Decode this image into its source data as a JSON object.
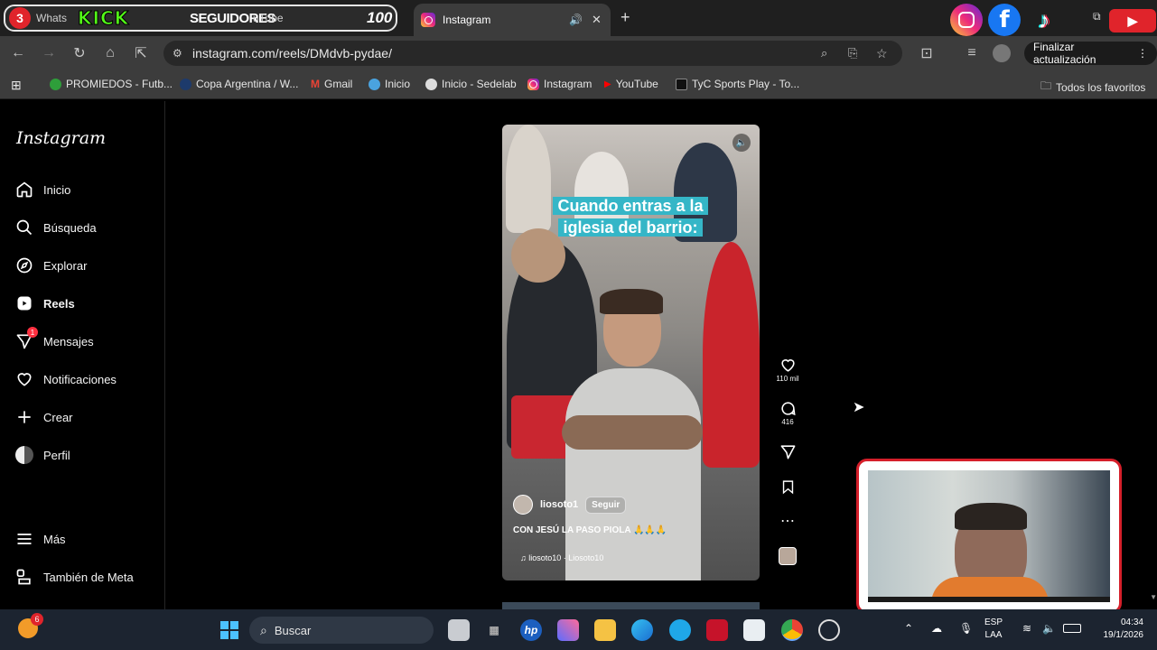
{
  "browser": {
    "tab_badge": "3",
    "tab1_text": "Whats",
    "overlay_kick": "KICK",
    "overlay_seguidores": "SEGUIDORES",
    "tab1_youtube": "uTube",
    "overlay_count": "100",
    "active_tab_title": "Instagram",
    "url": "instagram.com/reels/DMdvb-pydae/",
    "update_button": "Finalizar actualización",
    "bookmarks": [
      "PROMIEDOS - Futb...",
      "Copa Argentina / W...",
      "Gmail",
      "Inicio",
      "Inicio - Sedelab",
      "Instagram",
      "YouTube",
      "TyC Sports Play - To..."
    ],
    "all_bookmarks": "Todos los favoritos"
  },
  "instagram": {
    "logo": "Instagram",
    "nav": [
      {
        "label": "Inicio",
        "icon": "home-icon"
      },
      {
        "label": "Búsqueda",
        "icon": "search-icon"
      },
      {
        "label": "Explorar",
        "icon": "compass-icon"
      },
      {
        "label": "Reels",
        "icon": "reels-icon"
      },
      {
        "label": "Mensajes",
        "icon": "messenger-icon",
        "badge": "1"
      },
      {
        "label": "Notificaciones",
        "icon": "heart-icon"
      },
      {
        "label": "Crear",
        "icon": "plus-icon"
      },
      {
        "label": "Perfil",
        "icon": "avatar"
      }
    ],
    "more": "Más",
    "meta": "También de Meta",
    "reel": {
      "caption_overlay": "Cuando entras a la iglesia del barrio:",
      "username": "liosoto1",
      "follow": "Seguir",
      "description": "CON JESÚ LA PASO PIOLA 🙏🙏🙏",
      "audio": "liosoto10 · Liosoto10",
      "likes": "110 mil",
      "comments": "416",
      "more_icon": "⋯"
    }
  },
  "taskbar": {
    "search_placeholder": "Buscar",
    "notif_badge": "6",
    "lang": "ESP",
    "lang2": "LAA",
    "time": "04:34",
    "date": "19/1/2026"
  },
  "colors": {
    "instagram_bg": "#000000",
    "caption_bg": "#35b6c7",
    "cam_border": "#d51f2a",
    "kick_green": "#53fc18"
  }
}
